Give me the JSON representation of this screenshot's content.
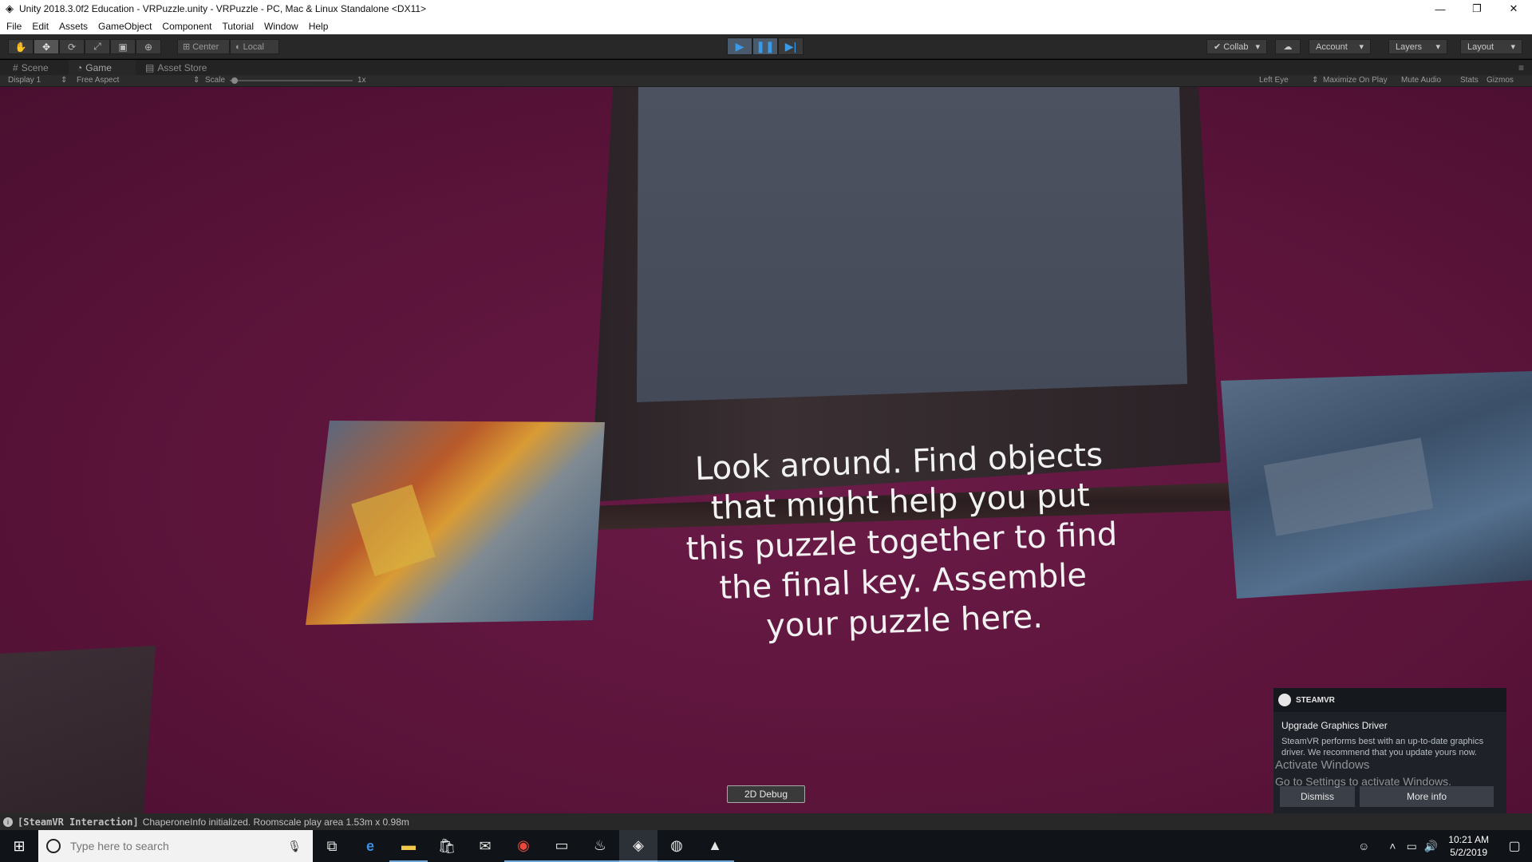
{
  "window": {
    "title": "Unity 2018.3.0f2 Education - VRPuzzle.unity - VRPuzzle - PC, Mac & Linux Standalone <DX11>",
    "minimize": "—",
    "maximize": "❐",
    "close": "✕"
  },
  "menu": [
    "File",
    "Edit",
    "Assets",
    "GameObject",
    "Component",
    "Tutorial",
    "Window",
    "Help"
  ],
  "toolbar": {
    "tools": [
      "hand-icon",
      "move-icon",
      "rotate-icon",
      "scale-icon",
      "rect-icon",
      "transform-icon"
    ],
    "pivot": "Center",
    "handle": "Local",
    "collab": "Collab",
    "account": "Account",
    "layers": "Layers",
    "layout": "Layout"
  },
  "tabs": [
    "Scene",
    "Game",
    "Asset Store"
  ],
  "gamebar": {
    "display": "Display 1",
    "aspect": "Free Aspect",
    "scale_label": "Scale",
    "scale_value": "1x",
    "eye": "Left Eye",
    "maximize": "Maximize On Play",
    "mute": "Mute Audio",
    "stats": "Stats",
    "gizmos": "Gizmos"
  },
  "game": {
    "instructions": "Look around. Find objects that might help you put this puzzle together to find the final key. Assemble your puzzle here.",
    "debug_button": "2D Debug"
  },
  "steamvr": {
    "brand": "STEAMVR",
    "heading": "Upgrade Graphics Driver",
    "body": "SteamVR performs best with an up-to-date graphics driver. We recommend that you update yours now.",
    "dismiss": "Dismiss",
    "more_info": "More info"
  },
  "watermark": {
    "line1": "Activate Windows",
    "line2": "Go to Settings to activate Windows."
  },
  "status": {
    "tag": "[SteamVR Interaction]",
    "message": "ChaperoneInfo initialized. Roomscale play area 1.53m x 0.98m"
  },
  "taskbar": {
    "search_placeholder": "Type here to search",
    "time": "10:21 AM",
    "date": "5/2/2019"
  }
}
